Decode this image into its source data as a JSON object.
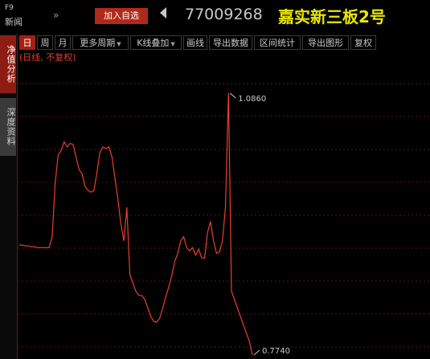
{
  "topbar": {
    "f9_label": "F9",
    "news_label": "新闻",
    "more_label": "»",
    "add_watchlist_label": "加入自选",
    "security_code": "77009268",
    "security_name": "嘉实新三板2号",
    "name_color": "#e8e800"
  },
  "sidebar": {
    "tabs": [
      {
        "label": "净值分析",
        "active": true
      },
      {
        "label": "深度资料",
        "active": false
      }
    ]
  },
  "toolbar": {
    "items": [
      {
        "label": "日",
        "active": true
      },
      {
        "label": "周"
      },
      {
        "label": "月"
      },
      {
        "label": "更多周期"
      },
      {
        "label": "K线叠加"
      },
      {
        "label": "画线"
      },
      {
        "label": "导出数据"
      },
      {
        "label": "区间统计"
      },
      {
        "label": "导出图形"
      },
      {
        "label": "复权"
      }
    ]
  },
  "chart_note": "(日线, 不复权)",
  "chart_data": {
    "type": "line",
    "line_color": "#e8402a",
    "grid": "dashed horizontal",
    "series": [
      {
        "values": [
          0.905,
          0.905,
          0.904,
          0.904,
          0.903,
          0.903,
          0.902,
          0.902,
          0.902,
          0.902,
          0.902,
          0.915,
          0.978,
          1.012,
          1.018,
          1.028,
          1.022,
          1.026,
          1.025,
          1.01,
          0.995,
          0.99,
          0.975,
          0.97,
          0.968,
          0.97,
          0.992,
          1.016,
          1.022,
          1.02,
          1.022,
          1.01,
          0.985,
          0.96,
          0.93,
          0.91,
          0.95,
          0.87,
          0.86,
          0.85,
          0.845,
          0.845,
          0.84,
          0.83,
          0.82,
          0.814,
          0.813,
          0.818,
          0.83,
          0.843,
          0.855,
          0.868,
          0.885,
          0.895,
          0.91,
          0.915,
          0.902,
          0.898,
          0.902,
          0.893,
          0.9,
          0.89,
          0.889,
          0.92,
          0.933,
          0.91,
          0.895,
          0.897,
          0.91,
          0.95,
          1.086,
          0.85,
          0.84,
          0.83,
          0.82,
          0.81,
          0.8,
          0.79,
          0.774
        ]
      }
    ],
    "annotations": [
      {
        "label": "1.0860",
        "value": 1.086
      },
      {
        "label": "0.7740",
        "value": 0.774
      }
    ]
  }
}
